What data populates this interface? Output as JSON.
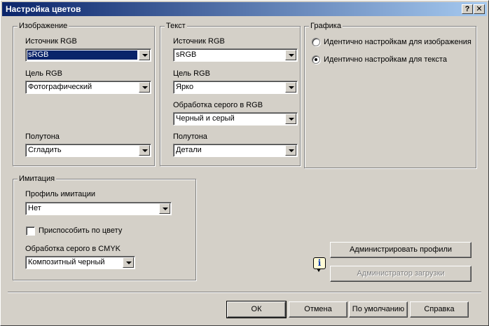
{
  "window": {
    "title": "Настройка цветов",
    "help_glyph": "?",
    "close_glyph": "✕"
  },
  "image_group": {
    "legend": "Изображение",
    "source_label": "Источник RGB",
    "source_value": "sRGB",
    "target_label": "Цель RGB",
    "target_value": "Фотографический",
    "halftone_label": "Полутона",
    "halftone_value": "Сгладить"
  },
  "text_group": {
    "legend": "Текст",
    "source_label": "Источник RGB",
    "source_value": "sRGB",
    "target_label": "Цель RGB",
    "target_value": "Ярко",
    "gray_label": "Обработка серого в RGB",
    "gray_value": "Черный и серый",
    "halftone_label": "Полутона",
    "halftone_value": "Детали"
  },
  "graphics_group": {
    "legend": "Графика",
    "option_image": "Идентично настройкам для изображения",
    "option_text": "Идентично настройкам для текста",
    "selected": "text"
  },
  "emulation_group": {
    "legend": "Имитация",
    "profile_label": "Профиль имитации",
    "profile_value": "Нет",
    "match_color_label": "Приспособить по цвету",
    "match_color_checked": false,
    "cmyk_gray_label": "Обработка серого в CMYK",
    "cmyk_gray_value": "Композитный черный"
  },
  "actions": {
    "manage_profiles": "Администрировать профили",
    "download_manager": "Администратор загрузки",
    "ok": "ОК",
    "cancel": "Отмена",
    "defaults": "По умолчанию",
    "help": "Справка"
  },
  "icons": {
    "info": "i"
  },
  "colors": {
    "face": "#d4d0c8",
    "titlebar_start": "#0a246a",
    "titlebar_end": "#a6caf0",
    "selection": "#0a246a"
  }
}
